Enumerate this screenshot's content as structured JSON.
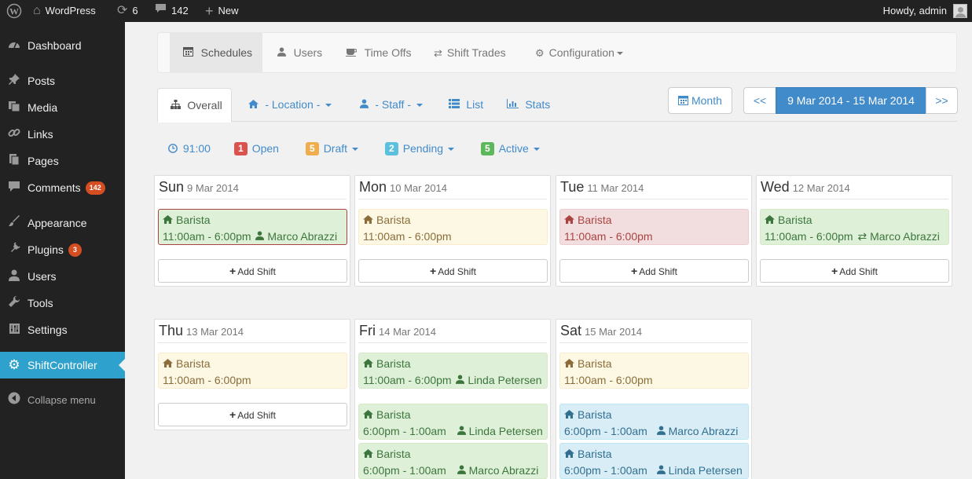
{
  "adminbar": {
    "site_name": "WordPress",
    "updates_count": "6",
    "comments_count": "142",
    "new_label": "New",
    "howdy": "Howdy, admin"
  },
  "menu": {
    "items": [
      {
        "label": "Dashboard",
        "icon": "dashboard-icon"
      },
      {
        "label": "Posts",
        "icon": "pin-icon"
      },
      {
        "label": "Media",
        "icon": "media-icon"
      },
      {
        "label": "Links",
        "icon": "link-icon"
      },
      {
        "label": "Pages",
        "icon": "pages-icon"
      },
      {
        "label": "Comments",
        "icon": "comments-icon",
        "badge": "142"
      },
      {
        "label": "Appearance",
        "icon": "brush-icon"
      },
      {
        "label": "Plugins",
        "icon": "plugin-icon",
        "badge": "3"
      },
      {
        "label": "Users",
        "icon": "user-icon"
      },
      {
        "label": "Tools",
        "icon": "wrench-icon"
      },
      {
        "label": "Settings",
        "icon": "settings-icon"
      },
      {
        "label": "ShiftController",
        "icon": "gear-icon"
      }
    ],
    "collapse_label": "Collapse menu"
  },
  "topnav": {
    "schedules": "Schedules",
    "users": "Users",
    "time_offs": "Time Offs",
    "shift_trades": "Shift Trades",
    "configuration": "Configuration"
  },
  "subtabs": {
    "overall": "Overall",
    "location": "- Location -",
    "staff": "- Staff -",
    "list": "List",
    "stats": "Stats"
  },
  "range": {
    "month_label": "Month",
    "prev": "<<",
    "current": "9 Mar 2014 - 15 Mar 2014",
    "next": ">>"
  },
  "stats": {
    "hours": "91:00",
    "open_count": "1",
    "open_label": "Open",
    "draft_count": "5",
    "draft_label": "Draft",
    "pending_count": "2",
    "pending_label": "Pending",
    "active_count": "5",
    "active_label": "Active"
  },
  "colors": {
    "open": "#d9534f",
    "draft": "#f0ad4e",
    "pending": "#5bc0de",
    "active": "#5cb85c",
    "accent": "#428bca"
  },
  "add_shift_label": "Add Shift",
  "days": [
    {
      "name": "Sun",
      "date": "9 Mar 2014",
      "shifts": [
        {
          "title": "Barista",
          "time": "11:00am - 6:00pm",
          "staff": "Marco Abrazzi",
          "staff_icon": "user-icon"
        }
      ]
    },
    {
      "name": "Mon",
      "date": "10 Mar 2014",
      "shifts": [
        {
          "title": "Barista",
          "time": "11:00am - 6:00pm",
          "staff": "",
          "staff_icon": ""
        }
      ]
    },
    {
      "name": "Tue",
      "date": "11 Mar 2014",
      "shifts": [
        {
          "title": "Barista",
          "time": "11:00am - 6:00pm",
          "staff": "",
          "staff_icon": ""
        }
      ]
    },
    {
      "name": "Wed",
      "date": "12 Mar 2014",
      "shifts": [
        {
          "title": "Barista",
          "time": "11:00am - 6:00pm",
          "staff": "Marco Abrazzi",
          "staff_icon": "trade-icon"
        }
      ]
    },
    {
      "name": "Thu",
      "date": "13 Mar 2014",
      "shifts": [
        {
          "title": "Barista",
          "time": "11:00am - 6:00pm",
          "staff": "",
          "staff_icon": ""
        }
      ]
    },
    {
      "name": "Fri",
      "date": "14 Mar 2014",
      "shifts": [
        {
          "title": "Barista",
          "time": "11:00am - 6:00pm",
          "staff": "Linda Petersen",
          "staff_icon": "user-icon"
        },
        {
          "title": "Barista",
          "time": "6:00pm - 1:00am",
          "staff": "Linda Petersen",
          "staff_icon": "user-icon"
        },
        {
          "title": "Barista",
          "time": "6:00pm - 1:00am",
          "staff": "Marco Abrazzi",
          "staff_icon": "user-icon"
        }
      ]
    },
    {
      "name": "Sat",
      "date": "15 Mar 2014",
      "shifts": [
        {
          "title": "Barista",
          "time": "11:00am - 6:00pm",
          "staff": "",
          "staff_icon": ""
        },
        {
          "title": "Barista",
          "time": "6:00pm - 1:00am",
          "staff": "Marco Abrazzi",
          "staff_icon": "user-icon"
        },
        {
          "title": "Barista",
          "time": "6:00pm - 1:00am",
          "staff": "Linda Petersen",
          "staff_icon": "user-icon"
        }
      ]
    }
  ]
}
